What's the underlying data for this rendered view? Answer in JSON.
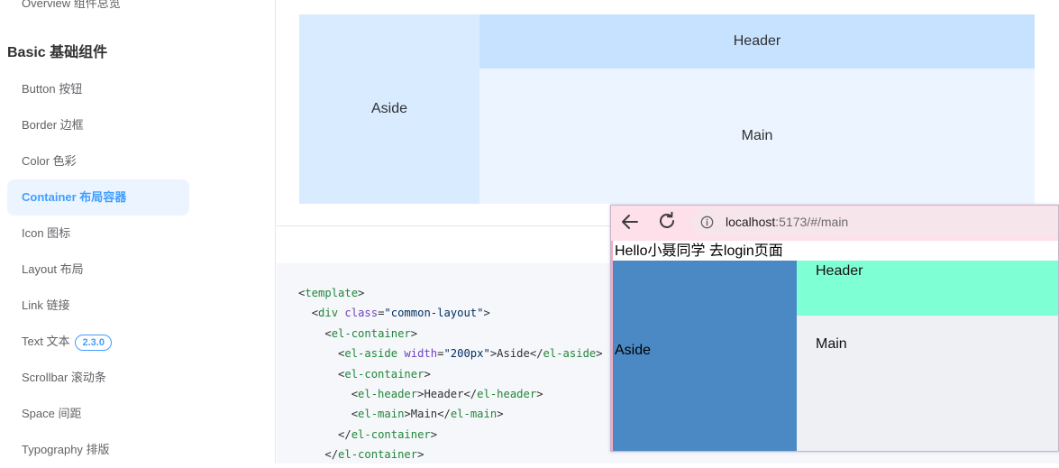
{
  "sidebar": {
    "prev_item": "Overview 组件总览",
    "group_title": "Basic 基础组件",
    "items": [
      {
        "label": "Button 按钮",
        "active": false
      },
      {
        "label": "Border 边框",
        "active": false
      },
      {
        "label": "Color 色彩",
        "active": false
      },
      {
        "label": "Container 布局容器",
        "active": true
      },
      {
        "label": "Icon 图标",
        "active": false
      },
      {
        "label": "Layout 布局",
        "active": false
      },
      {
        "label": "Link 链接",
        "active": false
      },
      {
        "label": "Text 文本",
        "active": false,
        "badge": "2.3.0"
      },
      {
        "label": "Scrollbar 滚动条",
        "active": false
      },
      {
        "label": "Space 间距",
        "active": false
      },
      {
        "label": "Typography 排版",
        "active": false
      }
    ]
  },
  "demo": {
    "aside": "Aside",
    "header": "Header",
    "main": "Main"
  },
  "code_lines": [
    "<template>",
    "  <div class=\"common-layout\">",
    "    <el-container>",
    "      <el-aside width=\"200px\">Aside</el-aside>",
    "      <el-container>",
    "        <el-header>Header</el-header>",
    "        <el-main>Main</el-main>",
    "      </el-container>",
    "    </el-container>"
  ],
  "browser": {
    "back_icon": "arrow-left-icon",
    "reload_icon": "reload-icon",
    "info_icon": "info-circle-icon",
    "url_host": "localhost",
    "url_rest": ":5173/#/main",
    "page_text": "Hello小聂同学 去login页面",
    "aside": "Aside",
    "header": "Header",
    "main": "Main"
  },
  "colors": {
    "accent": "#409eff",
    "active_bg": "#ecf5ff",
    "demo_aside": "#d9ecff",
    "demo_header": "#c6e2ff",
    "browser_toolbar": "#fde0e9",
    "browser_aside": "#4b89c4",
    "browser_header": "#7fffd4",
    "browser_main": "#eef0f4"
  }
}
